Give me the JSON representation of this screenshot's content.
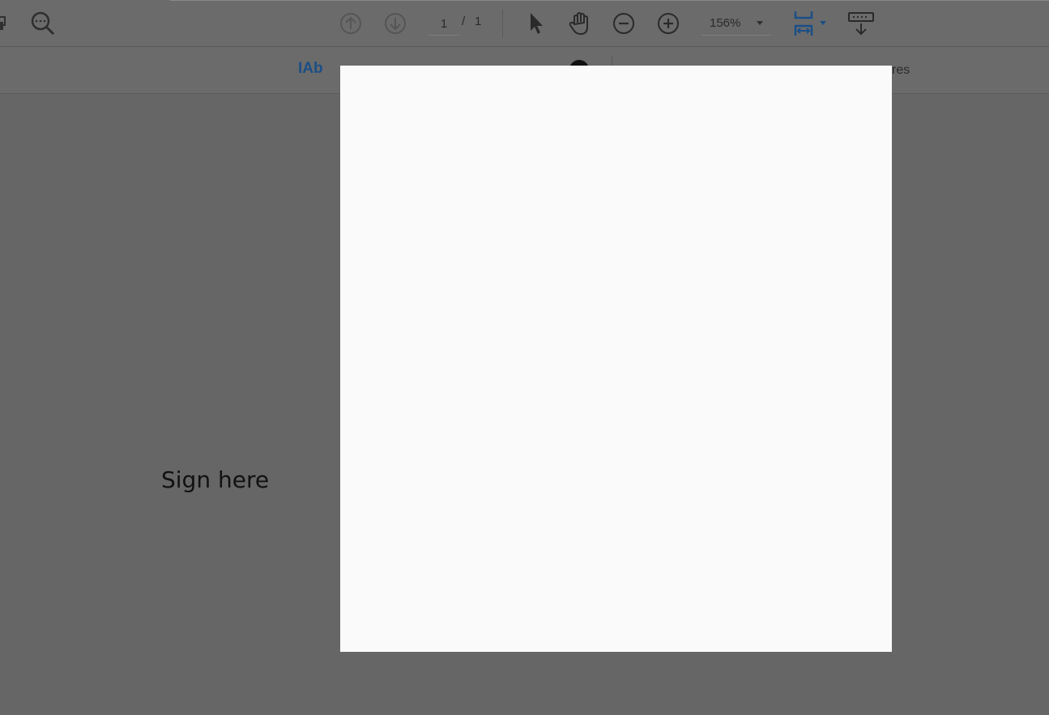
{
  "toolbar": {
    "page_current": "1",
    "page_separator": "/",
    "page_total": "1",
    "zoom": "156%",
    "icons": [
      "print-icon",
      "search-icon",
      "prev-page-icon",
      "next-page-icon",
      "select-icon",
      "hand-icon",
      "zoom-out-icon",
      "zoom-in-icon",
      "fit-width-icon",
      "keyboard-icon"
    ]
  },
  "subtoolbar": {
    "add_text": "IAb",
    "partial_right": "res"
  },
  "canvas": {
    "sign_label": "Sign here"
  },
  "colors": {
    "background": "#666666",
    "toolbar": "#6b6b6b",
    "accent": "#1b4f86",
    "page": "#fafafa"
  }
}
